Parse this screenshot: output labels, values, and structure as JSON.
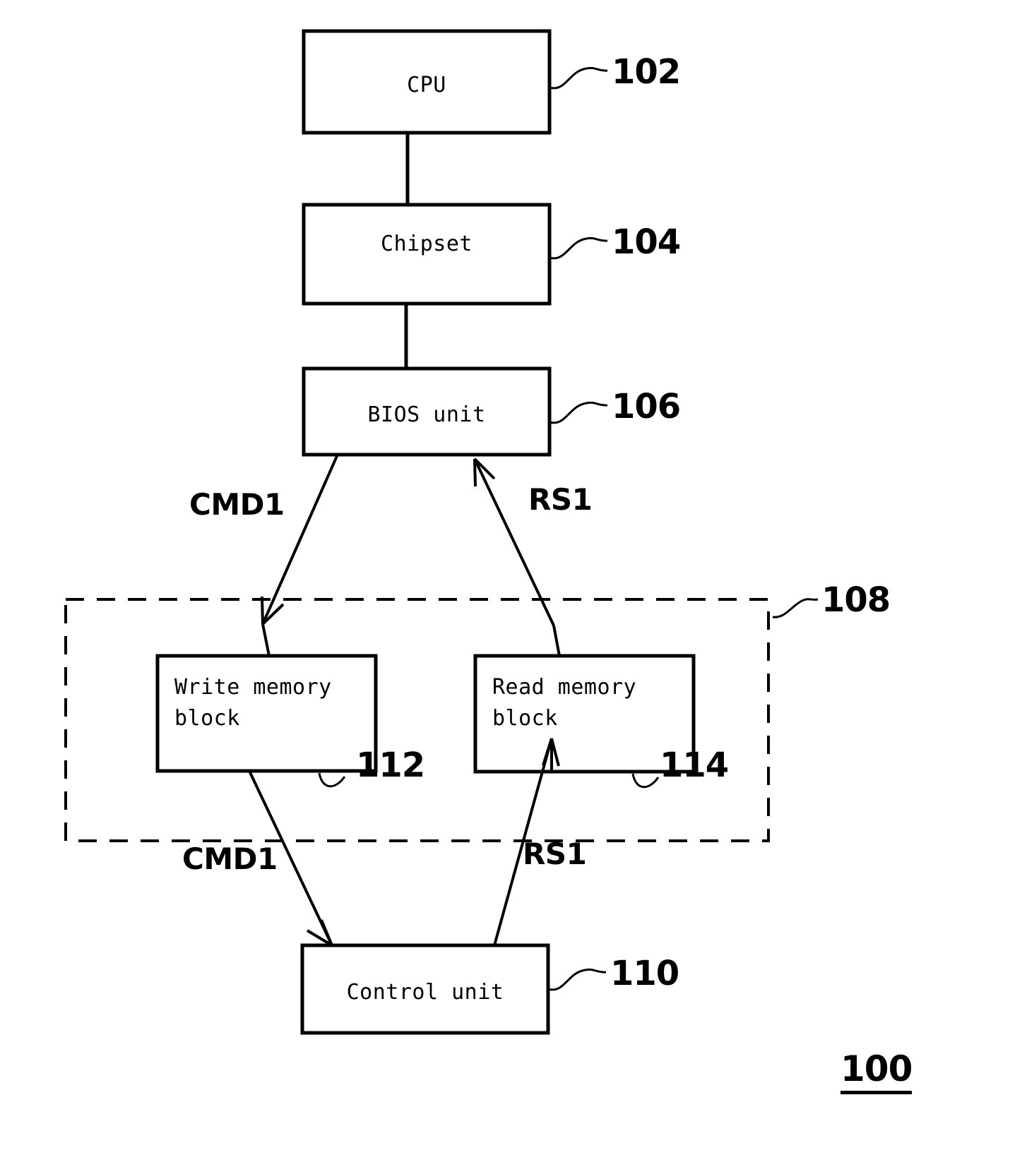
{
  "figure": {
    "id": "100",
    "type": "block-diagram",
    "title_number": "100"
  },
  "blocks": [
    {
      "key": "cpu",
      "label": "CPU",
      "ref": "102",
      "align": "center"
    },
    {
      "key": "chipset",
      "label": "Chipset",
      "ref": "104",
      "align": "center"
    },
    {
      "key": "bios_unit",
      "label": "BIOS unit",
      "ref": "106",
      "align": "center"
    },
    {
      "key": "write_memory",
      "label": "Write memory\nblock",
      "ref": "112",
      "align": "left"
    },
    {
      "key": "read_memory",
      "label": "Read memory\nblock",
      "ref": "114",
      "align": "left"
    },
    {
      "key": "control_unit",
      "label": "Control unit",
      "ref": "110",
      "align": "center"
    }
  ],
  "groups": [
    {
      "key": "memory_group",
      "ref": "108",
      "style": "dashed",
      "contains": [
        "write_memory",
        "read_memory"
      ]
    }
  ],
  "signals": {
    "cmd_top": "CMD1",
    "rs_top": "RS1",
    "cmd_bottom": "CMD1",
    "rs_bottom": "RS1"
  },
  "connections": [
    {
      "from": "cpu",
      "to": "chipset",
      "arrow": "none",
      "label": ""
    },
    {
      "from": "chipset",
      "to": "bios_unit",
      "arrow": "none",
      "label": ""
    },
    {
      "from": "bios_unit",
      "to": "write_memory",
      "arrow": "end",
      "label": "CMD1"
    },
    {
      "from": "read_memory",
      "to": "bios_unit",
      "arrow": "end",
      "label": "RS1"
    },
    {
      "from": "write_memory",
      "to": "control_unit",
      "arrow": "end",
      "label": "CMD1"
    },
    {
      "from": "control_unit",
      "to": "read_memory",
      "arrow": "end",
      "label": "RS1"
    }
  ],
  "colors": {
    "stroke": "#000000",
    "background": "#ffffff",
    "text": "#000000"
  }
}
